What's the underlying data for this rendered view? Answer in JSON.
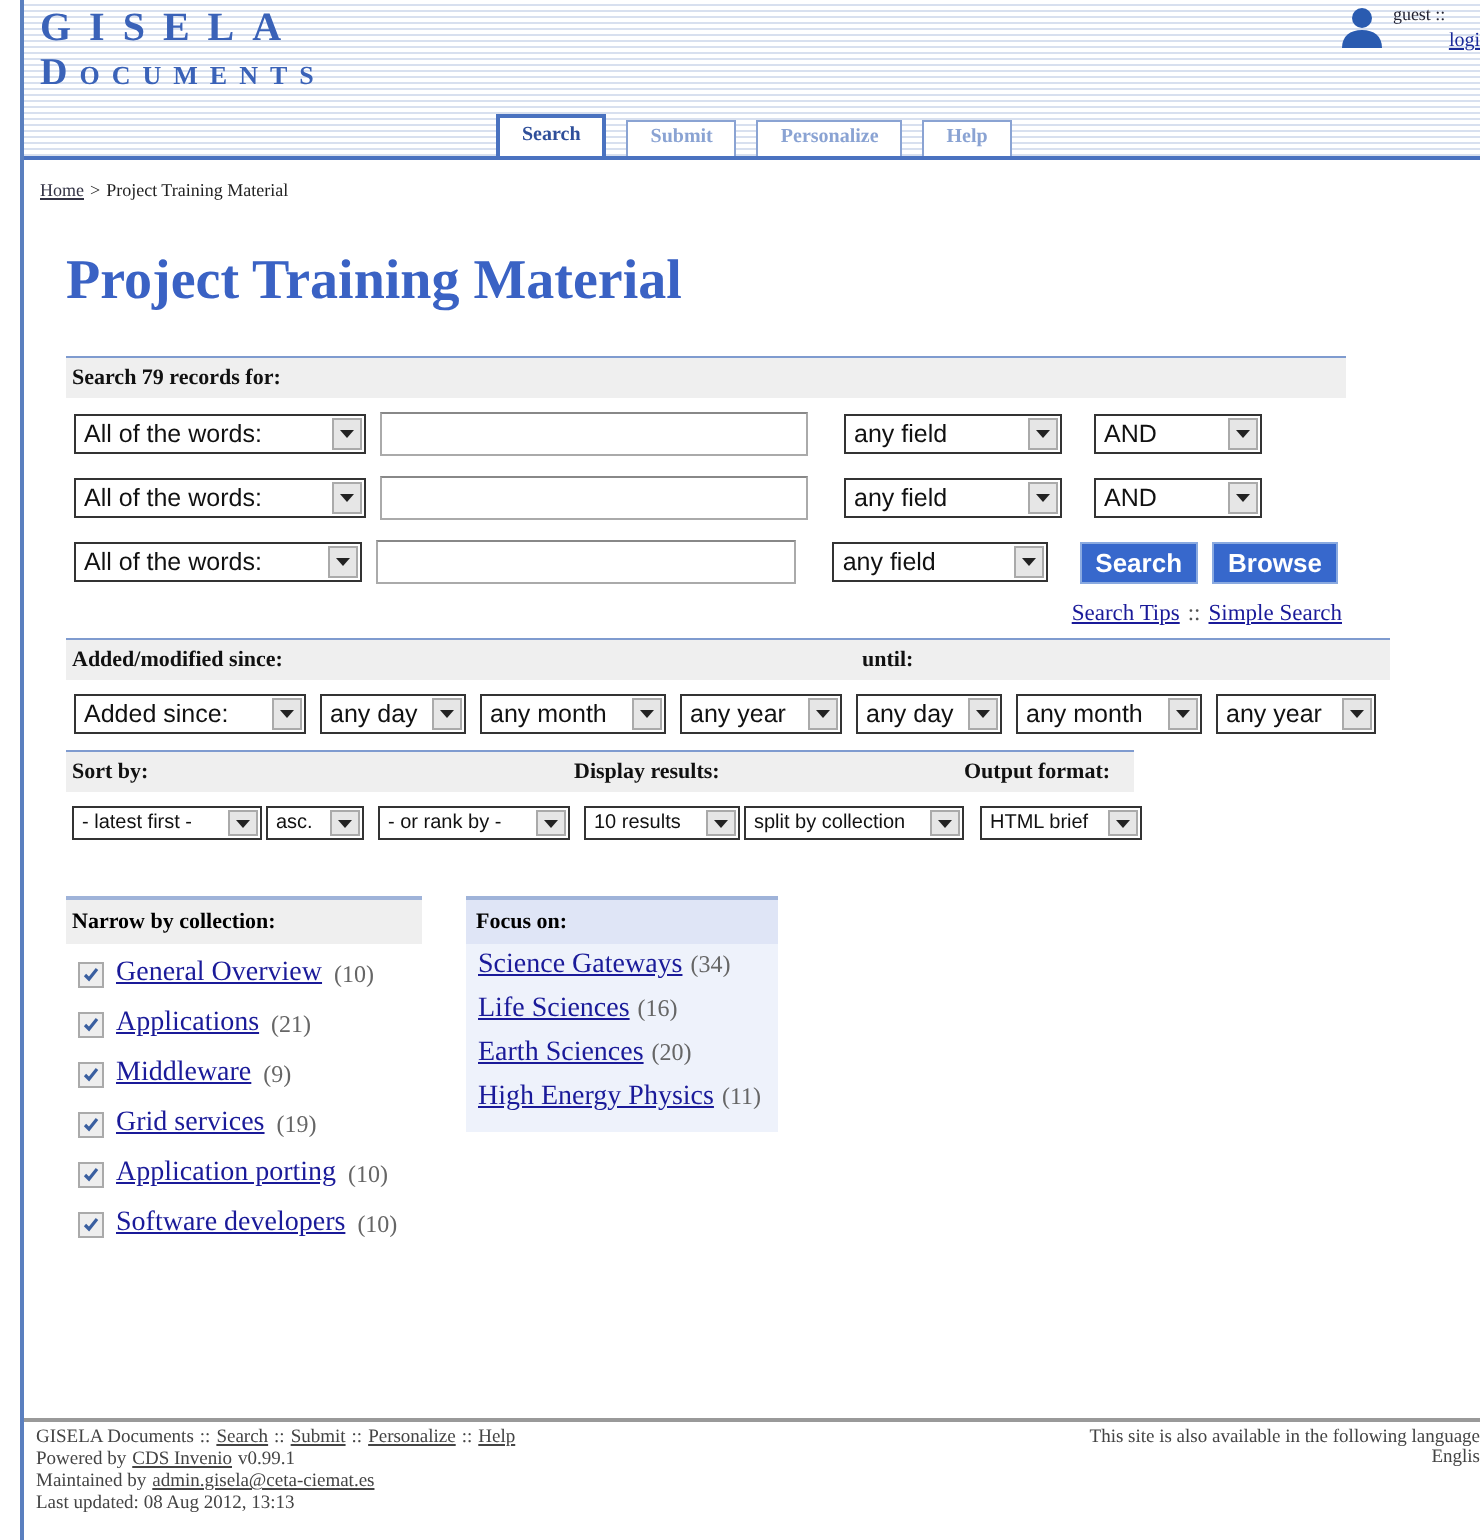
{
  "header": {
    "logo_line1": "GISELA",
    "logo_line2": "DOCUMENTS",
    "user": "guest ::",
    "login": "logi"
  },
  "tabs": [
    {
      "label": "Search",
      "selected": true
    },
    {
      "label": "Submit",
      "selected": false
    },
    {
      "label": "Personalize",
      "selected": false
    },
    {
      "label": "Help",
      "selected": false
    }
  ],
  "breadcrumb": {
    "home": "Home",
    "separator": ">",
    "current": "Project Training Material"
  },
  "title": "Project Training Material",
  "search": {
    "heading": "Search 79 records for:",
    "rows": [
      {
        "match": "All of the words:",
        "field": "any field",
        "operator": "AND"
      },
      {
        "match": "All of the words:",
        "field": "any field",
        "operator": "AND"
      },
      {
        "match": "All of the words:",
        "field": "any field"
      }
    ],
    "buttons": [
      "Search",
      "Browse"
    ],
    "links": [
      "Search Tips",
      "Simple Search"
    ],
    "link_separator": "::"
  },
  "dates": {
    "since_label": "Added/modified since:",
    "until_label": "until:",
    "since": [
      "Added since:",
      "any day",
      "any month",
      "any year"
    ],
    "until": [
      "any day",
      "any month",
      "any year"
    ]
  },
  "sort": {
    "labels": [
      "Sort by:",
      "Display results:",
      "Output format:"
    ],
    "selects": [
      "- latest first -",
      "asc.",
      "- or rank by -",
      "10 results",
      "split by collection",
      "HTML brief"
    ]
  },
  "collections": {
    "heading": "Narrow by collection:",
    "items": [
      {
        "label": "General Overview",
        "count": "(10)",
        "checked": true
      },
      {
        "label": "Applications",
        "count": "(21)",
        "checked": true
      },
      {
        "label": "Middleware",
        "count": "(9)",
        "checked": true
      },
      {
        "label": "Grid services",
        "count": "(19)",
        "checked": true
      },
      {
        "label": "Application porting",
        "count": "(10)",
        "checked": true
      },
      {
        "label": "Software developers",
        "count": "(10)",
        "checked": true
      }
    ]
  },
  "focus": {
    "heading": "Focus on:",
    "items": [
      {
        "label": "Science Gateways",
        "count": "(34)"
      },
      {
        "label": "Life Sciences",
        "count": "(16)"
      },
      {
        "label": "Earth Sciences",
        "count": "(20)"
      },
      {
        "label": "High Energy Physics",
        "count": "(11)"
      }
    ]
  },
  "footer": {
    "site": "GISELA Documents",
    "separator": "::",
    "links": [
      "Search",
      "Submit",
      "Personalize",
      "Help"
    ],
    "powered_prefix": "Powered by",
    "powered_link": "CDS Invenio",
    "powered_version": "v0.99.1",
    "maintained_prefix": "Maintained by",
    "maintained_link": "admin.gisela@ceta-ciemat.es",
    "updated": "Last updated: 08 Aug 2012, 13:13",
    "languages_note": "This site is also available in the following language",
    "language": "Englis"
  }
}
